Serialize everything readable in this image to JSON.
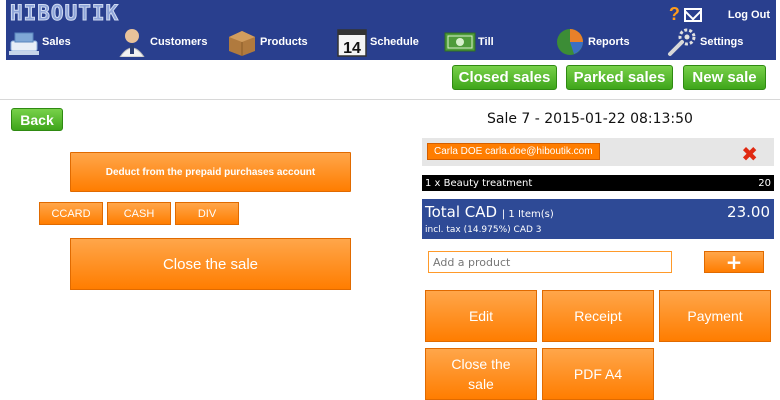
{
  "header": {
    "logo": "HIBOUTIK",
    "logout_label": "Log Out",
    "help_icon": "?",
    "mail_icon": "envelope-icon",
    "nav": [
      {
        "label": "Sales",
        "icon": "cash-register-icon",
        "color": "#7fa7d6"
      },
      {
        "label": "Customers",
        "icon": "user-icon",
        "color": "#e8c29a"
      },
      {
        "label": "Products",
        "icon": "box-icon",
        "color": "#b07a3e"
      },
      {
        "label": "Schedule",
        "icon": "calendar-icon",
        "color": "#e8e8e8",
        "badge": "14"
      },
      {
        "label": "Till",
        "icon": "money-icon",
        "color": "#4f9c3a"
      },
      {
        "label": "Reports",
        "icon": "pie-chart-icon",
        "color": "#4a8a3a"
      },
      {
        "label": "Settings",
        "icon": "wrench-icon",
        "color": "#c8c8c8"
      }
    ]
  },
  "toolbar": {
    "closed_sales": "Closed sales",
    "parked_sales": "Parked sales",
    "new_sale": "New sale"
  },
  "left": {
    "back": "Back",
    "deduct": "Deduct from the prepaid purchases account",
    "payment_methods": [
      "CCARD",
      "CASH",
      "DIV"
    ],
    "close_sale": "Close the sale"
  },
  "sale": {
    "title": "Sale 7 - 2015-01-22 08:13:50",
    "customer": "Carla DOE carla.doe@hiboutik.com",
    "remove_icon": "✖",
    "line": {
      "description": "1 x Beauty treatment",
      "amount": "20"
    },
    "total_label": "Total CAD",
    "total_items": "| 1 Item(s)",
    "total_amount": "23.00",
    "tax_line": "incl. tax  (14.975%) CAD 3",
    "add_placeholder": "Add a product",
    "plus": "+"
  },
  "actions": {
    "edit": "Edit",
    "receipt": "Receipt",
    "payment": "Payment",
    "close_sale": "Close the sale",
    "pdf": "PDF A4"
  },
  "colors": {
    "nav_bg": "#293f8e",
    "orange": "#ff7d00",
    "green": "#4fb626",
    "total_bg": "#2e4a96"
  }
}
